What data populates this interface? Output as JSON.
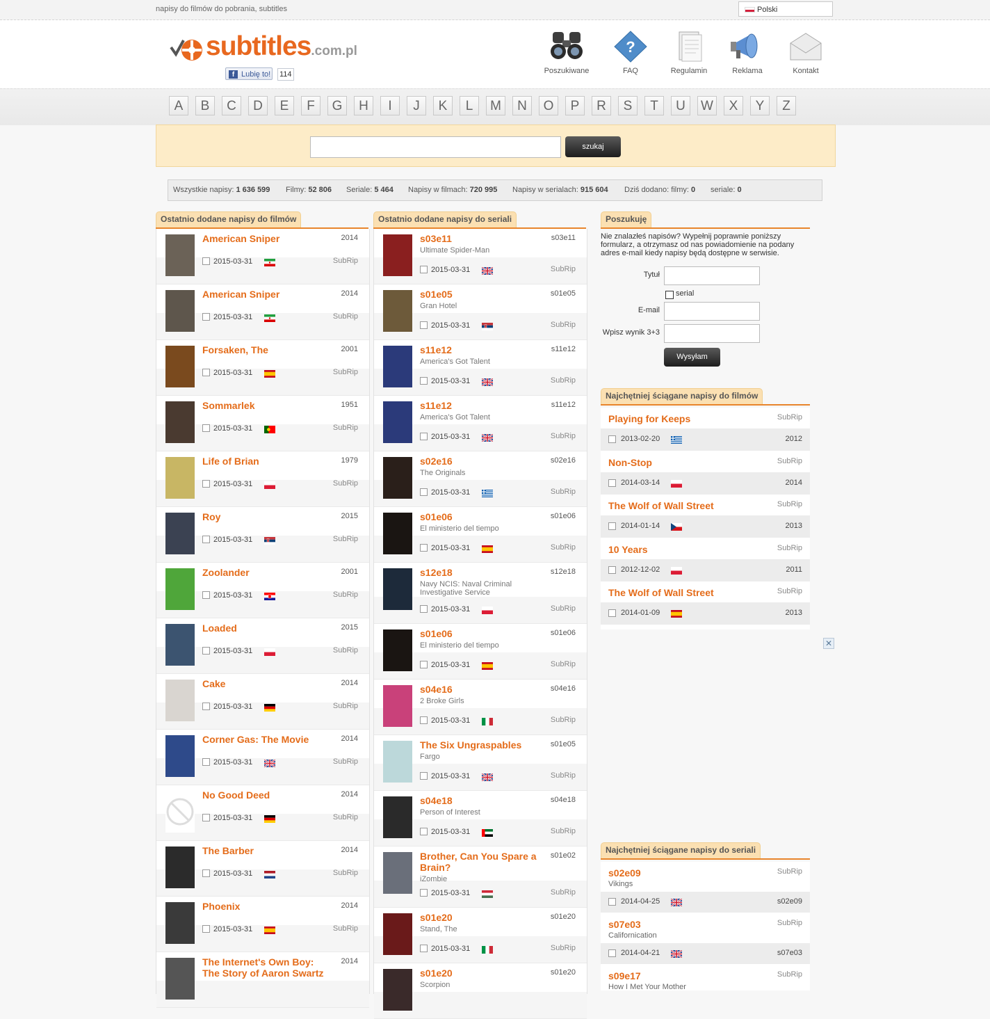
{
  "topbar": {
    "tagline": "napisy do filmów do pobrania, subtitles",
    "language": "Polski"
  },
  "logo": {
    "name": "subtitles",
    "tld": ".com.pl"
  },
  "facebook": {
    "like_label": "Lubię to!",
    "count": "114"
  },
  "nav": [
    {
      "label": "Poszukiwane",
      "icon": "binoculars-icon"
    },
    {
      "label": "FAQ",
      "icon": "question-icon"
    },
    {
      "label": "Regulamin",
      "icon": "document-icon"
    },
    {
      "label": "Reklama",
      "icon": "megaphone-icon"
    },
    {
      "label": "Kontakt",
      "icon": "envelope-icon"
    }
  ],
  "letters": [
    "A",
    "B",
    "C",
    "D",
    "E",
    "F",
    "G",
    "H",
    "I",
    "J",
    "K",
    "L",
    "M",
    "N",
    "O",
    "P",
    "R",
    "S",
    "T",
    "U",
    "W",
    "X",
    "Y",
    "Z"
  ],
  "search": {
    "button": "szukaj",
    "value": ""
  },
  "stats": {
    "all_label": "Wszystkie napisy:",
    "all_value": "1 636 599",
    "films_label": "Filmy:",
    "films_value": "52 806",
    "series_label": "Seriale:",
    "series_value": "5 464",
    "in_films_label": "Napisy w filmach:",
    "in_films_value": "720 995",
    "in_series_label": "Napisy w serialach:",
    "in_series_value": "915 604",
    "today_label": "Dziś dodano: filmy:",
    "today_films": "0",
    "today_series_label": "seriale:",
    "today_series": "0"
  },
  "colors": {
    "accent": "#e46c1a",
    "tab_bg": "#fbe0b2",
    "search_bg": "#fdecc8"
  },
  "films": {
    "heading": "Ostatnio dodane napisy do filmów",
    "items": [
      {
        "title": "American Sniper",
        "year": "2014",
        "date": "2015-03-31",
        "lang": "ir",
        "format": "SubRip"
      },
      {
        "title": "American Sniper",
        "year": "2014",
        "date": "2015-03-31",
        "lang": "ir",
        "format": "SubRip"
      },
      {
        "title": "Forsaken, The",
        "year": "2001",
        "date": "2015-03-31",
        "lang": "es",
        "format": "SubRip"
      },
      {
        "title": "Sommarlek",
        "year": "1951",
        "date": "2015-03-31",
        "lang": "pt",
        "format": "SubRip"
      },
      {
        "title": "Life of Brian",
        "year": "1979",
        "date": "2015-03-31",
        "lang": "pl",
        "format": "SubRip"
      },
      {
        "title": "Roy",
        "year": "2015",
        "date": "2015-03-31",
        "lang": "rs",
        "format": "SubRip"
      },
      {
        "title": "Zoolander",
        "year": "2001",
        "date": "2015-03-31",
        "lang": "hr",
        "format": "SubRip"
      },
      {
        "title": "Loaded",
        "year": "2015",
        "date": "2015-03-31",
        "lang": "pl",
        "format": "SubRip"
      },
      {
        "title": "Cake",
        "year": "2014",
        "date": "2015-03-31",
        "lang": "de",
        "format": "SubRip"
      },
      {
        "title": "Corner Gas: The Movie",
        "year": "2014",
        "date": "2015-03-31",
        "lang": "gb",
        "format": "SubRip"
      },
      {
        "title": "No Good Deed",
        "year": "2014",
        "date": "2015-03-31",
        "lang": "de",
        "format": "SubRip"
      },
      {
        "title": "The Barber",
        "year": "2014",
        "date": "2015-03-31",
        "lang": "nl",
        "format": "SubRip"
      },
      {
        "title": "Phoenix",
        "year": "2014",
        "date": "2015-03-31",
        "lang": "es",
        "format": "SubRip"
      },
      {
        "title": "The Internet's Own Boy: The Story of Aaron Swartz",
        "year": "2014",
        "date": "",
        "lang": "",
        "format": ""
      }
    ]
  },
  "series": {
    "heading": "Ostatnio dodane napisy do seriali",
    "items": [
      {
        "title": "s03e11",
        "show": "Ultimate Spider-Man",
        "ep": "s03e11",
        "date": "2015-03-31",
        "lang": "gb",
        "format": "SubRip"
      },
      {
        "title": "s01e05",
        "show": "Gran Hotel",
        "ep": "s01e05",
        "date": "2015-03-31",
        "lang": "rs",
        "format": "SubRip"
      },
      {
        "title": "s11e12",
        "show": "America's Got Talent",
        "ep": "s11e12",
        "date": "2015-03-31",
        "lang": "gb",
        "format": "SubRip"
      },
      {
        "title": "s11e12",
        "show": "America's Got Talent",
        "ep": "s11e12",
        "date": "2015-03-31",
        "lang": "gb",
        "format": "SubRip"
      },
      {
        "title": "s02e16",
        "show": "The Originals",
        "ep": "s02e16",
        "date": "2015-03-31",
        "lang": "gr",
        "format": "SubRip"
      },
      {
        "title": "s01e06",
        "show": "El ministerio del tiempo",
        "ep": "s01e06",
        "date": "2015-03-31",
        "lang": "es",
        "format": "SubRip"
      },
      {
        "title": "s12e18",
        "show": "Navy NCIS: Naval Criminal Investigative Service",
        "ep": "s12e18",
        "date": "2015-03-31",
        "lang": "pl",
        "format": "SubRip"
      },
      {
        "title": "s01e06",
        "show": "El ministerio del tiempo",
        "ep": "s01e06",
        "date": "2015-03-31",
        "lang": "es",
        "format": "SubRip"
      },
      {
        "title": "s04e16",
        "show": "2 Broke Girls",
        "ep": "s04e16",
        "date": "2015-03-31",
        "lang": "it",
        "format": "SubRip"
      },
      {
        "title": "The Six Ungraspables",
        "show": "Fargo",
        "ep": "s01e05",
        "date": "2015-03-31",
        "lang": "gb",
        "format": "SubRip"
      },
      {
        "title": "s04e18",
        "show": "Person of Interest",
        "ep": "s04e18",
        "date": "2015-03-31",
        "lang": "ae",
        "format": "SubRip"
      },
      {
        "title": "Brother, Can You Spare a Brain?",
        "show": "iZombie",
        "ep": "s01e02",
        "date": "2015-03-31",
        "lang": "hu",
        "format": "SubRip"
      },
      {
        "title": "s01e20",
        "show": "Stand, The",
        "ep": "s01e20",
        "date": "2015-03-31",
        "lang": "it",
        "format": "SubRip"
      },
      {
        "title": "s01e20",
        "show": "Scorpion",
        "ep": "s01e20",
        "date": "",
        "lang": "",
        "format": ""
      }
    ]
  },
  "request": {
    "heading": "Poszukuję",
    "text": "Nie znalazłeś napisów? Wypełnij poprawnie poniższy formularz, a otrzymasz od nas powiadomienie na podany adres e-mail kiedy napisy będą dostępne w serwisie.",
    "title_label": "Tytuł",
    "serial_label": "serial",
    "email_label": "E-mail",
    "captcha_label": "Wpisz wynik 3+3",
    "button": "Wysyłam"
  },
  "top_films": {
    "heading": "Najchętniej ściągane napisy do filmów",
    "items": [
      {
        "title": "Playing for Keeps",
        "format": "SubRip",
        "date": "2013-02-20",
        "lang": "gr",
        "year": "2012"
      },
      {
        "title": "Non-Stop",
        "format": "SubRip",
        "date": "2014-03-14",
        "lang": "pl",
        "year": "2014"
      },
      {
        "title": "The Wolf of Wall Street",
        "format": "SubRip",
        "date": "2014-01-14",
        "lang": "cz",
        "year": "2013"
      },
      {
        "title": "10 Years",
        "format": "SubRip",
        "date": "2012-12-02",
        "lang": "pl",
        "year": "2011"
      },
      {
        "title": "The Wolf of Wall Street",
        "format": "SubRip",
        "date": "2014-01-09",
        "lang": "es",
        "year": "2013"
      }
    ]
  },
  "top_series": {
    "heading": "Najchętniej ściągane napisy do seriali",
    "items": [
      {
        "title": "s02e09",
        "show": "Vikings",
        "format": "SubRip",
        "date": "2014-04-25",
        "lang": "gb",
        "ep": "s02e09"
      },
      {
        "title": "s07e03",
        "show": "Californication",
        "format": "SubRip",
        "date": "2014-04-21",
        "lang": "gb",
        "ep": "s07e03"
      },
      {
        "title": "s09e17",
        "show": "How I Met Your Mother",
        "format": "SubRip",
        "date": "",
        "lang": "",
        "ep": ""
      }
    ]
  }
}
